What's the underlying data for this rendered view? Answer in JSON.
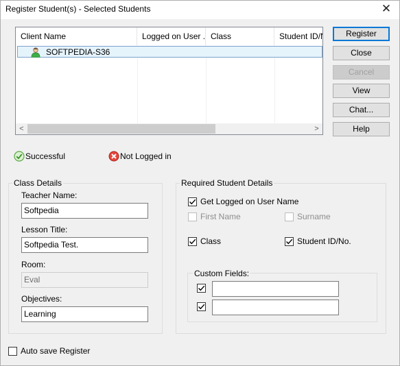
{
  "window": {
    "title": "Register Student(s) - Selected Students",
    "close_glyph": "✕"
  },
  "list": {
    "columns": [
      "Client Name",
      "Logged on User ...",
      "Class",
      "Student ID/No"
    ],
    "rows": [
      {
        "name": "SOFTPEDIA-S36",
        "icon": "student-user-icon"
      }
    ],
    "scroll_left": "<",
    "scroll_right": ">"
  },
  "buttons": {
    "register": "Register",
    "close": "Close",
    "cancel": "Cancel",
    "view": "View",
    "chat": "Chat...",
    "help": "Help"
  },
  "legend": {
    "successful": "Successful",
    "not_logged_in": "Not Logged in"
  },
  "class_details": {
    "title": "Class Details",
    "teacher_label": "Teacher Name:",
    "teacher_value": "Softpedia",
    "lesson_label": "Lesson Title:",
    "lesson_value": "Softpedia Test.",
    "room_label": "Room:",
    "room_value": "Eval",
    "objectives_label": "Objectives:",
    "objectives_value": "Learning"
  },
  "required": {
    "title": "Required Student Details",
    "get_logged_on": {
      "label": "Get Logged on User Name",
      "checked": true
    },
    "first_name": {
      "label": "First Name",
      "checked": false
    },
    "surname": {
      "label": "Surname",
      "checked": false
    },
    "class": {
      "label": "Class",
      "checked": true
    },
    "student_id": {
      "label": "Student ID/No.",
      "checked": true
    },
    "custom_fields_title": "Custom Fields:",
    "custom_field_1": "",
    "custom_field_2": ""
  },
  "auto_save": {
    "label": "Auto save Register",
    "checked": false
  },
  "colors": {
    "accent": "#0078d7",
    "success": "#5cb85c",
    "error": "#d9534f"
  }
}
